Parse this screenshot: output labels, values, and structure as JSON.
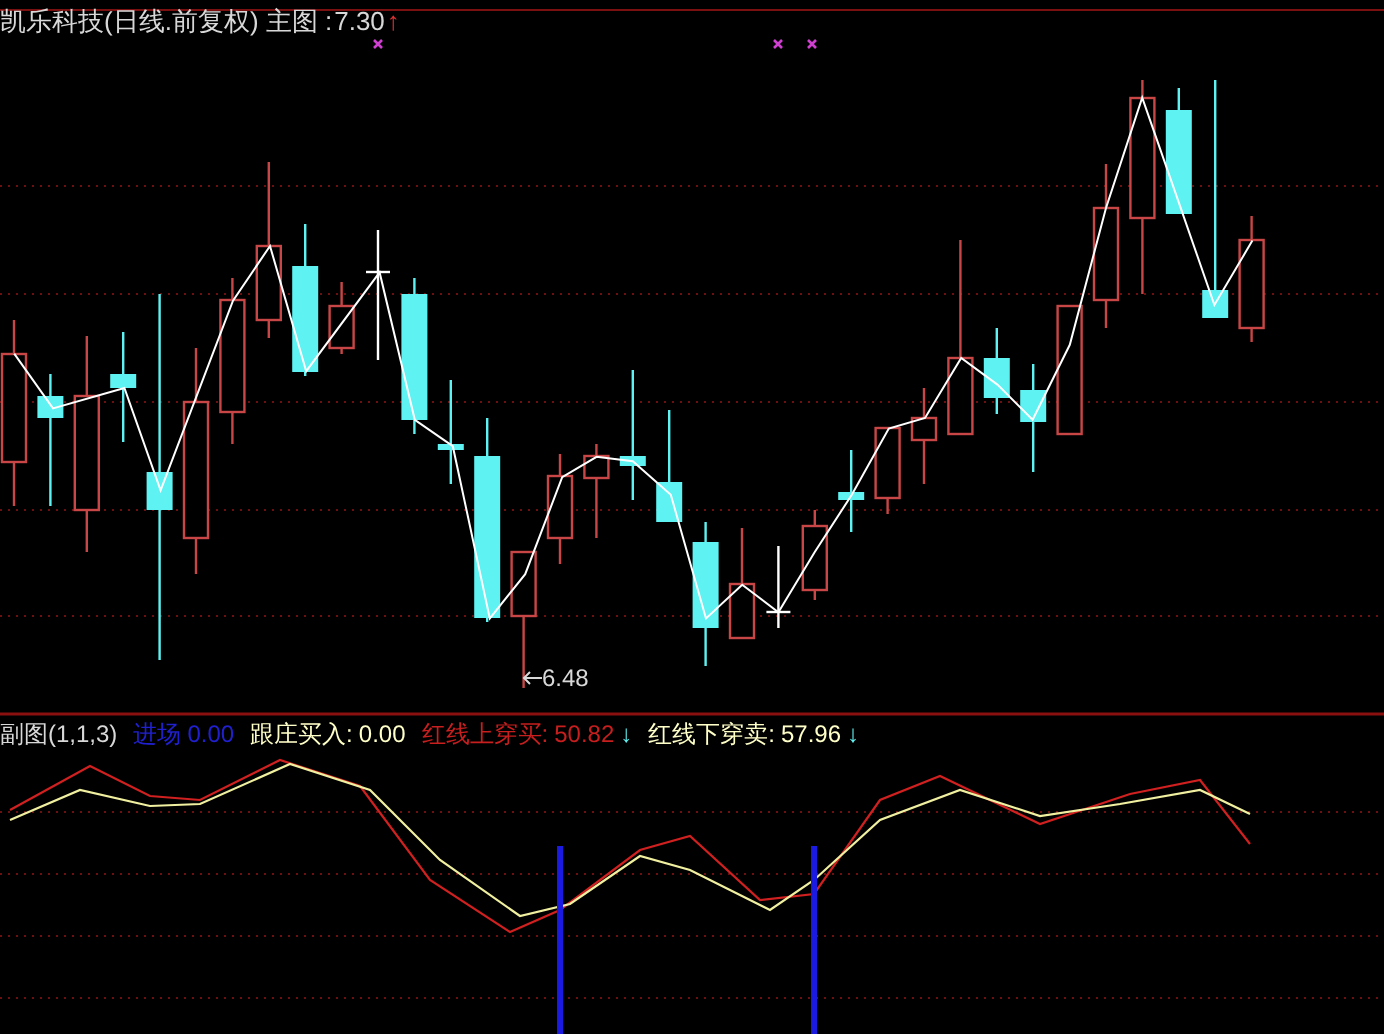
{
  "main_chart": {
    "title": "凯乐科技(日线.前复权) 主图 :",
    "value": "7.30",
    "arrow": "↑",
    "low_label": "6.48"
  },
  "sub_chart": {
    "title": "副图(1,1,3)",
    "indicators": [
      {
        "label": "进场",
        "value": "0.00",
        "color": "#2020d0"
      },
      {
        "label": "跟庄买入:",
        "value": "0.00",
        "color": "#ffffc8"
      },
      {
        "label": "红线上穿买:",
        "value": "50.82",
        "color": "#c81e1e",
        "arrow": "↓"
      },
      {
        "label": "红线下穿卖:",
        "value": "57.96",
        "color": "#ffffc8",
        "arrow": "↓"
      }
    ]
  }
}
